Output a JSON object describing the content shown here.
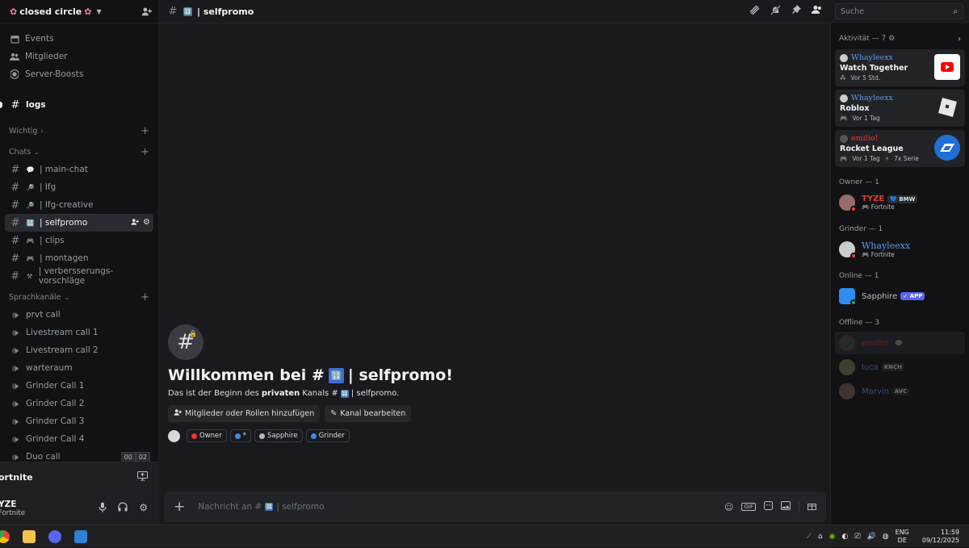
{
  "server": {
    "name": "closed circle"
  },
  "nav": [
    {
      "label": "Events",
      "icon": "calendar-icon"
    },
    {
      "label": "Mitglieder",
      "icon": "members-icon"
    },
    {
      "label": "Server-Boosts",
      "icon": "boost-icon"
    }
  ],
  "unread_channel": "logs",
  "categories": {
    "important": "Wichtig",
    "chats": "Chats",
    "voice": "Sprachkanäle"
  },
  "text_channels": [
    {
      "label": "| main-chat",
      "emoji": "💬"
    },
    {
      "label": "| lfg",
      "emoji": "🔎"
    },
    {
      "label": "| lfg-creative",
      "emoji": "🔎"
    },
    {
      "label": "| selfpromo",
      "emoji": "🔢",
      "active": true
    },
    {
      "label": "| clips",
      "emoji": "🎮"
    },
    {
      "label": "| montagen",
      "emoji": "🎮"
    },
    {
      "label": "| verbersserungs-vorschläge",
      "emoji": "⚒"
    }
  ],
  "voice_channels": [
    "prvt call",
    "Livestream call 1",
    "Livestream call 2",
    "warteraum",
    "Grinder Call 1",
    "Grinder Call 2",
    "Grinder Call 3",
    "Grinder Call 4",
    "Duo call"
  ],
  "duo_badge": [
    "00",
    "02"
  ],
  "voice_status": {
    "title": "ortnite"
  },
  "user": {
    "name": "YZE",
    "status": "Fortnite"
  },
  "header": {
    "channel": "| selfpromo",
    "emoji": "🔢"
  },
  "search": {
    "placeholder": "Suche"
  },
  "welcome": {
    "title_prefix": "Willkommen bei #",
    "title_suffix": "| selfpromo!",
    "sub_prefix": "Das ist der Beginn des",
    "sub_bold": "privaten",
    "sub_mid": "Kanals #",
    "sub_suffix": "| selfpromo.",
    "btn_add": "Mitglieder oder Rollen hinzufügen",
    "btn_edit": "Kanal bearbeiten"
  },
  "roles": [
    {
      "label": "Owner",
      "color": "#e53935"
    },
    {
      "label": "*",
      "color": "#3b8bea"
    },
    {
      "label": "Sapphire",
      "color": "#b5bac1"
    },
    {
      "label": "Grinder",
      "color": "#3b8bea"
    }
  ],
  "composer": {
    "prefix": "Nachricht an #",
    "suffix": "| selfpromo"
  },
  "activity": {
    "header": "Aktivität — 7",
    "cards": [
      {
        "user": "Whayleexx",
        "game": "Watch Together",
        "meta": [
          "Vor 5 Std."
        ],
        "color": "#ff0000"
      },
      {
        "user": "Whayleexx",
        "game": "Roblox",
        "meta": [
          "Vor 1 Tag"
        ],
        "color": "#e6e6e6"
      },
      {
        "user": "emilio!",
        "game": "Rocket League",
        "meta": [
          "Vor 1 Tag",
          "7x Serie"
        ],
        "color": "#1f6fd6"
      }
    ]
  },
  "groups": {
    "owner": "Owner — 1",
    "grinder": "Grinder — 1",
    "online": "Online — 1",
    "offline": "Offline — 3"
  },
  "members": {
    "owner": {
      "name": "TYZE",
      "tag": "BMW",
      "sub": "Fortnite"
    },
    "grinder": {
      "name": "Whayleexx",
      "sub": "Fortnite"
    },
    "online": {
      "name": "Sapphire",
      "tag": "APP"
    },
    "offline": [
      {
        "name": "emilio!",
        "tag": ""
      },
      {
        "name": "luca",
        "tag": "KNCH"
      },
      {
        "name": "Marvin",
        "tag": "AVC"
      }
    ]
  },
  "tray": {
    "lang1": "ENG",
    "lang2": "DE",
    "time": "11:59",
    "date": "09/12/2025"
  }
}
